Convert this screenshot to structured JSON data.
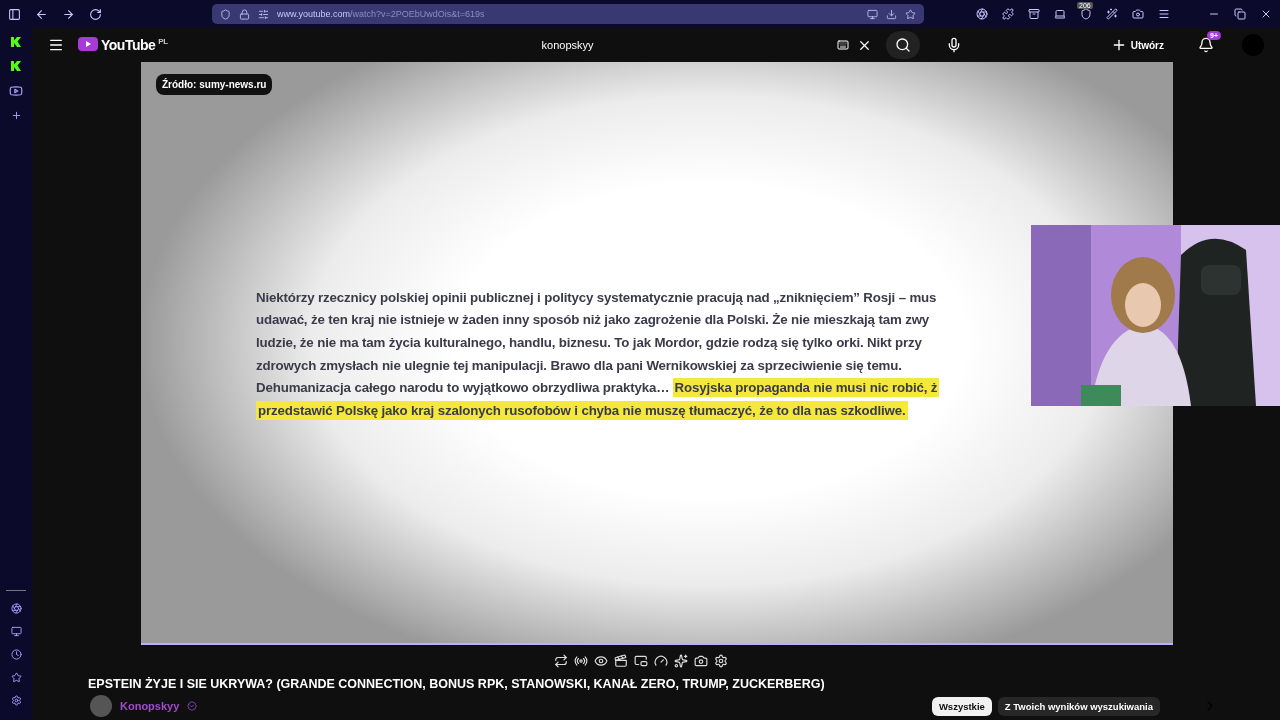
{
  "browser": {
    "url_host": "www.youtube.com",
    "url_path": "/watch?v=2POEbUwdOis&t=619s",
    "extension_badge": "206"
  },
  "header": {
    "logo_text": "YouTube",
    "region": "PL",
    "search": {
      "value": "konopskyy"
    },
    "create_label": "Utwórz",
    "notification_badge": "9+"
  },
  "video": {
    "source_badge": "Źródło: sumy-news.ru",
    "lines": [
      {
        "segments": [
          {
            "text": "Niektórzy rzecznicy polskiej opinii publicznej i politycy systematycznie pracują nad „zniknięciem” Rosji – mus",
            "highlighted": false
          }
        ]
      },
      {
        "segments": [
          {
            "text": "udawać, że ten kraj nie istnieje w żaden inny sposób niż jako zagrożenie dla Polski. Że nie mieszkają tam zwy",
            "highlighted": false
          }
        ]
      },
      {
        "segments": [
          {
            "text": "ludzie, że nie ma tam życia kulturalnego, handlu, biznesu. To jak Mordor, gdzie rodzą się tylko orki. Nikt przy",
            "highlighted": false
          }
        ]
      },
      {
        "segments": [
          {
            "text": "zdrowych zmysłach nie ulegnie tej manipulacji. Brawo dla pani Wernikowskiej za sprzeciwienie się temu.",
            "highlighted": false
          }
        ]
      },
      {
        "segments": [
          {
            "text": "Dehumanizacja całego narodu to wyjątkowo obrzydliwa praktyka…",
            "highlighted": false
          },
          {
            "text": "Rosyjska propaganda nie musi nic robić, ż",
            "highlighted": true
          }
        ]
      },
      {
        "segments": [
          {
            "text": "przedstawić Polskę jako kraj szalonych rusofobów i chyba nie muszę tłumaczyć, że to dla nas szkodliwe.",
            "highlighted": true
          }
        ]
      }
    ]
  },
  "title": "EPSTEIN ŻYJE I SIE UKRYWA? (GRANDE CONNECTION, BONUS RPK, STANOWSKI, KANAŁ ZERO, TRUMP, ZUCKERBERG)",
  "channel": {
    "name": "Konopskyy"
  },
  "chips": [
    {
      "label": "Wszystkie",
      "selected": true
    },
    {
      "label": "Z Twoich wyników wyszukiwania",
      "selected": false
    }
  ]
}
